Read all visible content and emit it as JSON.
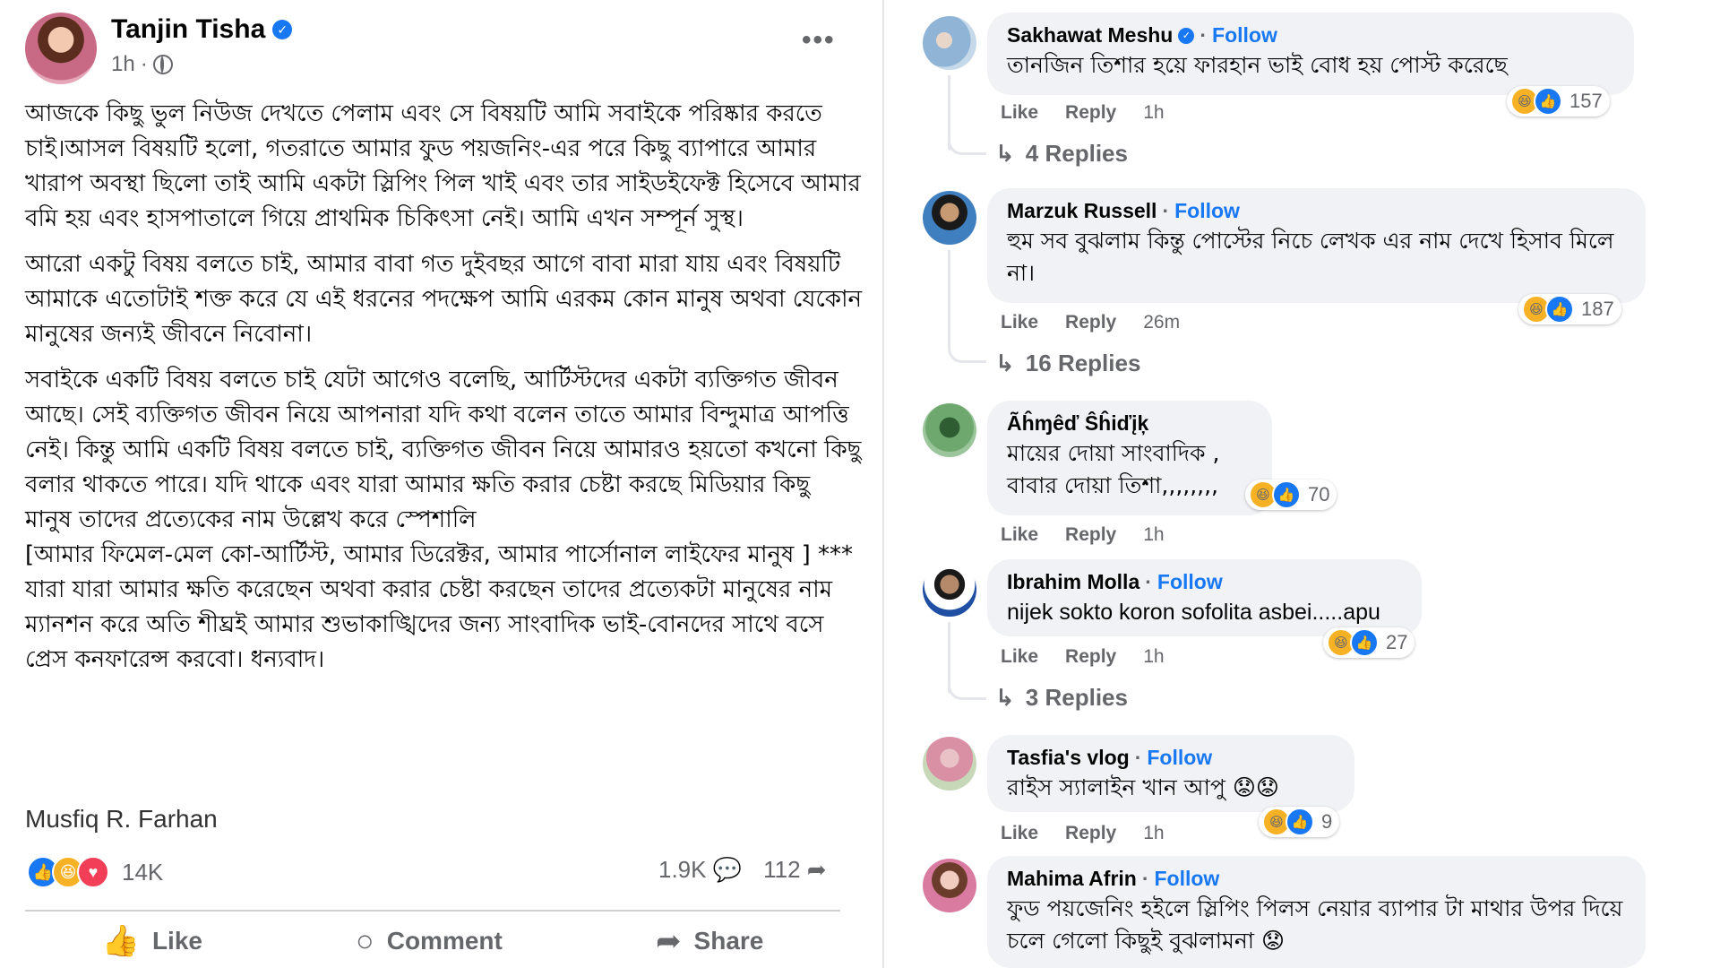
{
  "post": {
    "author": "Tanjin Tisha",
    "time": "1h",
    "more_label": "•••",
    "paragraphs": [
      "আজকে কিছু ভুল নিউজ দেখতে পেলাম এবং সে বিষয়টি আমি সবাইকে পরিষ্কার করতে চাই।আসল বিষয়টি হলো, গতরাতে আমার ফুড পয়জনিং-এর পরে কিছু ব্যাপারে আমার খারাপ অবস্থা ছিলো তাই আমি একটা স্লিপিং পিল খাই এবং তার সাইডইফেক্ট হিসেবে আমার বমি হয় এবং হাসপাতালে গিয়ে প্রাথমিক চিকিৎসা নেই। আমি এখন সম্পূর্ন সুস্থ।",
      " আরো একটু বিষয় বলতে চাই, আমার বাবা গত দুইবছর আগে বাবা মারা যায় এবং বিষয়টি আমাকে এতোটাই শক্ত করে যে এই ধরনের পদক্ষেপ আমি এরকম কোন মানুষ অথবা যেকোন মানুষের জন্যই জীবনে নিবোনা।",
      "সবাইকে একটি বিষয় বলতে চাই যেটা আগেও বলেছি, আর্টিস্টদের একটা ব্যক্তিগত জীবন আছে। সেই ব্যক্তিগত জীবন নিয়ে আপনারা যদি কথা বলেন তাতে আমার বিন্দুমাত্র আপত্তি নেই। কিন্তু আমি একটি বিষয় বলতে চাই, ব্যক্তিগত জীবন নিয়ে আমারও হয়তো কখনো কিছু বলার থাকতে পারে। যদি থাকে এবং যারা আমার ক্ষতি করার চেষ্টা করছে মিডিয়ার কিছু মানুষ তাদের প্রত্যেকের নাম উল্লেখ করে স্পেশালি\n [আমার ফিমেল-মেল কো-আর্টিস্ট, আমার ডিরেক্টর, আমার পার্সোনাল লাইফের মানুষ ] ***\nযারা যারা আমার ক্ষতি করেছেন অথবা করার চেষ্টা করছেন তাদের প্রত্যেকটা মানুষের নাম ম্যানশন করে অতি শীঘ্রই আমার শুভাকাঙ্খিদের জন্য সাংবাদিক ভাই-বোনদের সাথে বসে প্রেস কনফারেন্স করবো। ধন্যবাদ।"
    ],
    "signature": "Musfiq R. Farhan",
    "reaction_count": "14K",
    "comment_count": "1.9K",
    "share_count": "112",
    "actions": {
      "like": "Like",
      "comment": "Comment",
      "share": "Share"
    }
  },
  "colors": {
    "accent": "#1877f2",
    "bubble": "#f0f2f5",
    "muted": "#65676b"
  },
  "comments": [
    {
      "name": "Sakhawat Meshu",
      "follow": "Follow",
      "text": "তানজিন তিশার হয়ে ফারহান ভাই বোধ হয় পোস্ট করেছে",
      "like": "Like",
      "reply": "Reply",
      "time": "1h",
      "reactions": "157",
      "replies": "4 Replies"
    },
    {
      "name": "Marzuk Russell",
      "follow": "Follow",
      "text": "হুম সব বুঝলাম কিন্তু পোস্টের নিচে লেখক এর নাম দেখে হিসাব মিলে না।",
      "like": "Like",
      "reply": "Reply",
      "time": "26m",
      "reactions": "187",
      "replies": "16 Replies"
    },
    {
      "name": "Ãĥɱêď Ŝĥiďįķ",
      "text": "মায়ের দোয়া সাংবাদিক ,\nবাবার দোয়া তিশা,,,,,,,,",
      "like": "Like",
      "reply": "Reply",
      "time": "1h",
      "reactions": "70"
    },
    {
      "name": "Ibrahim Molla",
      "follow": "Follow",
      "text": "nijek sokto koron sofolita asbei.....apu",
      "like": "Like",
      "reply": "Reply",
      "time": "1h",
      "reactions": "27",
      "replies": "3 Replies"
    },
    {
      "name": "Tasfia's vlog",
      "follow": "Follow",
      "text": "রাইস স্যালাইন খান আপু 😟😟",
      "like": "Like",
      "reply": "Reply",
      "time": "1h",
      "reactions": "9"
    },
    {
      "name": "Mahima Afrin",
      "follow": "Follow",
      "text": "ফুড পয়জেনিং হইলে স্লিপিং পিলস নেয়ার ব্যাপার টা মাথার উপর দিয়ে চলে গেলো কিছুই বুঝলামনা 😟"
    }
  ]
}
